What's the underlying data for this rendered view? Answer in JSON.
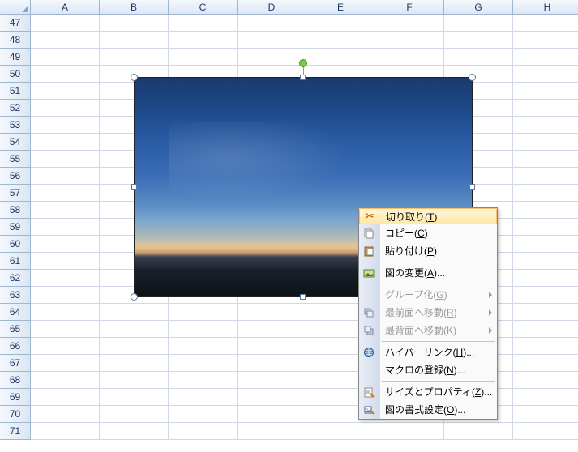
{
  "columns": [
    "A",
    "B",
    "C",
    "D",
    "E",
    "F",
    "G",
    "H"
  ],
  "rowStart": 47,
  "rowEnd": 71,
  "menu": {
    "items": [
      {
        "label": "切り取り",
        "key": "T",
        "icon": "cut",
        "enabled": true,
        "highlighted": true,
        "submenu": false,
        "sepAfter": false
      },
      {
        "label": "コピー",
        "key": "C",
        "icon": "copy",
        "enabled": true,
        "highlighted": false,
        "submenu": false,
        "sepAfter": false
      },
      {
        "label": "貼り付け",
        "key": "P",
        "icon": "paste",
        "enabled": true,
        "highlighted": false,
        "submenu": false,
        "sepAfter": true
      },
      {
        "label": "図の変更",
        "key": "A",
        "suffix": "...",
        "icon": "change-picture",
        "enabled": true,
        "highlighted": false,
        "submenu": false,
        "sepAfter": true
      },
      {
        "label": "グループ化",
        "key": "G",
        "icon": "",
        "enabled": false,
        "highlighted": false,
        "submenu": true,
        "sepAfter": false
      },
      {
        "label": "最前面へ移動",
        "key": "R",
        "icon": "bring-front",
        "enabled": false,
        "highlighted": false,
        "submenu": true,
        "sepAfter": false
      },
      {
        "label": "最背面へ移動",
        "key": "K",
        "icon": "send-back",
        "enabled": false,
        "highlighted": false,
        "submenu": true,
        "sepAfter": true
      },
      {
        "label": "ハイパーリンク",
        "key": "H",
        "suffix": "...",
        "icon": "hyperlink",
        "enabled": true,
        "highlighted": false,
        "submenu": false,
        "sepAfter": false
      },
      {
        "label": "マクロの登録",
        "key": "N",
        "suffix": "...",
        "icon": "",
        "enabled": true,
        "highlighted": false,
        "submenu": false,
        "sepAfter": true
      },
      {
        "label": "サイズとプロパティ",
        "key": "Z",
        "suffix": "...",
        "icon": "size-props",
        "enabled": true,
        "highlighted": false,
        "submenu": false,
        "sepAfter": false
      },
      {
        "label": "図の書式設定",
        "key": "O",
        "suffix": "...",
        "icon": "format-picture",
        "enabled": true,
        "highlighted": false,
        "submenu": false,
        "sepAfter": false
      }
    ]
  }
}
